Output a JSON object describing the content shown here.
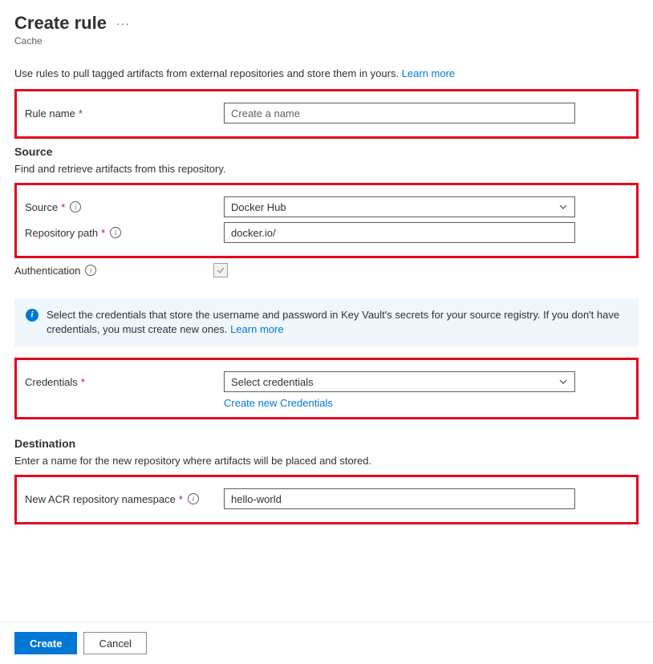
{
  "header": {
    "title": "Create rule",
    "subtitle": "Cache"
  },
  "intro": {
    "text": "Use rules to pull tagged artifacts from external repositories and store them in yours.",
    "link": "Learn more"
  },
  "ruleName": {
    "label": "Rule name",
    "placeholder": "Create a name",
    "value": ""
  },
  "sourceSection": {
    "heading": "Source",
    "desc": "Find and retrieve artifacts from this repository.",
    "source": {
      "label": "Source",
      "value": "Docker Hub"
    },
    "repoPath": {
      "label": "Repository path",
      "value": "docker.io/"
    },
    "auth": {
      "label": "Authentication",
      "checked": true
    }
  },
  "infoBanner": {
    "text": "Select the credentials that store the username and password in Key Vault's secrets for your source registry. If you don't have credentials, you must create new ones.",
    "link": "Learn more"
  },
  "credentials": {
    "label": "Credentials",
    "placeholder": "Select credentials",
    "createLink": "Create new Credentials"
  },
  "destination": {
    "heading": "Destination",
    "desc": "Enter a name for the new repository where artifacts will be placed and stored.",
    "namespace": {
      "label": "New ACR repository namespace",
      "value": "hello-world"
    }
  },
  "footer": {
    "create": "Create",
    "cancel": "Cancel"
  }
}
